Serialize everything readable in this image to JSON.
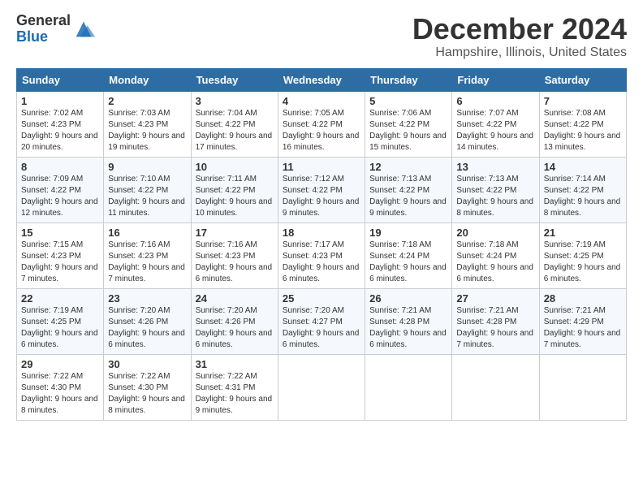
{
  "logo": {
    "general": "General",
    "blue": "Blue"
  },
  "title": "December 2024",
  "subtitle": "Hampshire, Illinois, United States",
  "days_header": [
    "Sunday",
    "Monday",
    "Tuesday",
    "Wednesday",
    "Thursday",
    "Friday",
    "Saturday"
  ],
  "weeks": [
    [
      {
        "day": "1",
        "sunrise": "7:02 AM",
        "sunset": "4:23 PM",
        "daylight": "9 hours and 20 minutes."
      },
      {
        "day": "2",
        "sunrise": "7:03 AM",
        "sunset": "4:23 PM",
        "daylight": "9 hours and 19 minutes."
      },
      {
        "day": "3",
        "sunrise": "7:04 AM",
        "sunset": "4:22 PM",
        "daylight": "9 hours and 17 minutes."
      },
      {
        "day": "4",
        "sunrise": "7:05 AM",
        "sunset": "4:22 PM",
        "daylight": "9 hours and 16 minutes."
      },
      {
        "day": "5",
        "sunrise": "7:06 AM",
        "sunset": "4:22 PM",
        "daylight": "9 hours and 15 minutes."
      },
      {
        "day": "6",
        "sunrise": "7:07 AM",
        "sunset": "4:22 PM",
        "daylight": "9 hours and 14 minutes."
      },
      {
        "day": "7",
        "sunrise": "7:08 AM",
        "sunset": "4:22 PM",
        "daylight": "9 hours and 13 minutes."
      }
    ],
    [
      {
        "day": "8",
        "sunrise": "7:09 AM",
        "sunset": "4:22 PM",
        "daylight": "9 hours and 12 minutes."
      },
      {
        "day": "9",
        "sunrise": "7:10 AM",
        "sunset": "4:22 PM",
        "daylight": "9 hours and 11 minutes."
      },
      {
        "day": "10",
        "sunrise": "7:11 AM",
        "sunset": "4:22 PM",
        "daylight": "9 hours and 10 minutes."
      },
      {
        "day": "11",
        "sunrise": "7:12 AM",
        "sunset": "4:22 PM",
        "daylight": "9 hours and 9 minutes."
      },
      {
        "day": "12",
        "sunrise": "7:13 AM",
        "sunset": "4:22 PM",
        "daylight": "9 hours and 9 minutes."
      },
      {
        "day": "13",
        "sunrise": "7:13 AM",
        "sunset": "4:22 PM",
        "daylight": "9 hours and 8 minutes."
      },
      {
        "day": "14",
        "sunrise": "7:14 AM",
        "sunset": "4:22 PM",
        "daylight": "9 hours and 8 minutes."
      }
    ],
    [
      {
        "day": "15",
        "sunrise": "7:15 AM",
        "sunset": "4:23 PM",
        "daylight": "9 hours and 7 minutes."
      },
      {
        "day": "16",
        "sunrise": "7:16 AM",
        "sunset": "4:23 PM",
        "daylight": "9 hours and 7 minutes."
      },
      {
        "day": "17",
        "sunrise": "7:16 AM",
        "sunset": "4:23 PM",
        "daylight": "9 hours and 6 minutes."
      },
      {
        "day": "18",
        "sunrise": "7:17 AM",
        "sunset": "4:23 PM",
        "daylight": "9 hours and 6 minutes."
      },
      {
        "day": "19",
        "sunrise": "7:18 AM",
        "sunset": "4:24 PM",
        "daylight": "9 hours and 6 minutes."
      },
      {
        "day": "20",
        "sunrise": "7:18 AM",
        "sunset": "4:24 PM",
        "daylight": "9 hours and 6 minutes."
      },
      {
        "day": "21",
        "sunrise": "7:19 AM",
        "sunset": "4:25 PM",
        "daylight": "9 hours and 6 minutes."
      }
    ],
    [
      {
        "day": "22",
        "sunrise": "7:19 AM",
        "sunset": "4:25 PM",
        "daylight": "9 hours and 6 minutes."
      },
      {
        "day": "23",
        "sunrise": "7:20 AM",
        "sunset": "4:26 PM",
        "daylight": "9 hours and 6 minutes."
      },
      {
        "day": "24",
        "sunrise": "7:20 AM",
        "sunset": "4:26 PM",
        "daylight": "9 hours and 6 minutes."
      },
      {
        "day": "25",
        "sunrise": "7:20 AM",
        "sunset": "4:27 PM",
        "daylight": "9 hours and 6 minutes."
      },
      {
        "day": "26",
        "sunrise": "7:21 AM",
        "sunset": "4:28 PM",
        "daylight": "9 hours and 6 minutes."
      },
      {
        "day": "27",
        "sunrise": "7:21 AM",
        "sunset": "4:28 PM",
        "daylight": "9 hours and 7 minutes."
      },
      {
        "day": "28",
        "sunrise": "7:21 AM",
        "sunset": "4:29 PM",
        "daylight": "9 hours and 7 minutes."
      }
    ],
    [
      {
        "day": "29",
        "sunrise": "7:22 AM",
        "sunset": "4:30 PM",
        "daylight": "9 hours and 8 minutes."
      },
      {
        "day": "30",
        "sunrise": "7:22 AM",
        "sunset": "4:30 PM",
        "daylight": "9 hours and 8 minutes."
      },
      {
        "day": "31",
        "sunrise": "7:22 AM",
        "sunset": "4:31 PM",
        "daylight": "9 hours and 9 minutes."
      },
      null,
      null,
      null,
      null
    ]
  ],
  "labels": {
    "sunrise": "Sunrise:",
    "sunset": "Sunset:",
    "daylight": "Daylight:"
  }
}
